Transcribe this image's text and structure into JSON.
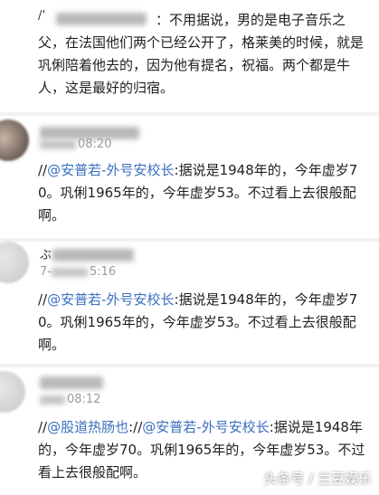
{
  "comments": [
    {
      "username": "/‘",
      "text": "：不用据说，男的是电子音乐之父，在法国他们两个已经公开了，格莱美的时候，就是巩俐陪着他去的，因为他有提名，祝福。两个都是牛人，这是最好的归宿。"
    },
    {
      "time": "08:20",
      "prefix": "//",
      "mention": "@安普若-外号安校长",
      "text": ":据说是1948年的，今年虚岁70。巩俐1965年的，今年虚岁53。不过看上去很般配啊。"
    },
    {
      "username": "ぶ",
      "time_prefix": "7-",
      "time": "5:16",
      "prefix": "//",
      "mention": "@安普若-外号安校长",
      "text": ":据说是1948年的，今年虚岁70。巩俐1965年的，今年虚岁53。不过看上去很般配啊。"
    },
    {
      "time": "08:12",
      "prefix": "//",
      "mention1": "@股道热肠也",
      "sep": "://",
      "mention2": "@安普若-外号安校长",
      "text": ":据说是1948年的，今年虚岁70。巩俐1965年的，今年虚岁53。不过看上去很般配啊。"
    }
  ],
  "watermark": "头条号 / 兰豆娱乐"
}
